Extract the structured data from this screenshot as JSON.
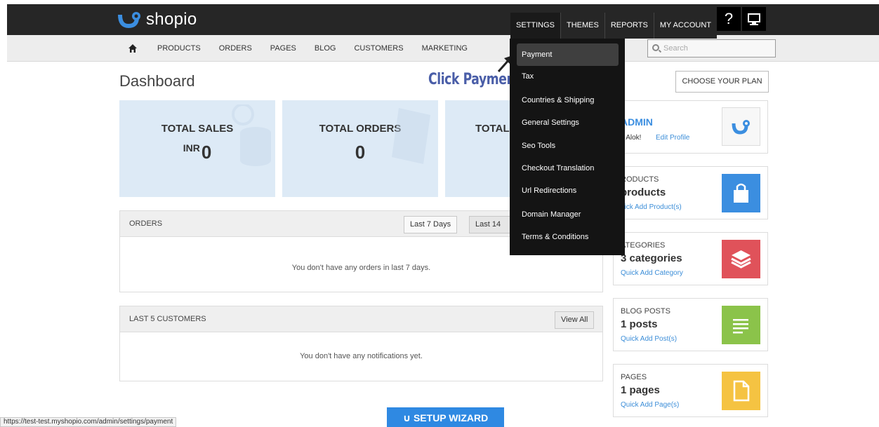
{
  "brand": {
    "name": "shopio"
  },
  "top_menu": {
    "tabs": [
      "SETTINGS",
      "THEMES",
      "REPORTS",
      "MY ACCOUNT"
    ],
    "help_icon": "question-icon",
    "display_icon": "monitor-icon"
  },
  "nav": {
    "items": [
      "PRODUCTS",
      "ORDERS",
      "PAGES",
      "BLOG",
      "CUSTOMERS",
      "MARKETING"
    ],
    "search_placeholder": "Search"
  },
  "page": {
    "title": "Dashboard",
    "annotation": "Click Payment"
  },
  "stats": [
    {
      "title": "TOTAL SALES",
      "currency": "INR",
      "value": "0"
    },
    {
      "title": "TOTAL ORDERS",
      "currency": "",
      "value": "0"
    },
    {
      "title": "TOTAL",
      "currency": "",
      "value": ""
    }
  ],
  "orders_panel": {
    "title": "ORDERS",
    "buttons": [
      "Last 7 Days",
      "Last 14 D"
    ],
    "empty_text": "You don't have any orders in last 7 days."
  },
  "customers_panel": {
    "title": "LAST 5 CUSTOMERS",
    "button": "View All",
    "empty_text": "You don't have any notifications yet."
  },
  "sidebar": {
    "plan_button": "CHOOSE YOUR PLAN",
    "admin": {
      "title": "ADMIN",
      "greeting": "i, Alok!",
      "edit_link": "Edit Profile"
    },
    "products": {
      "label": "RODUCTS",
      "count": " products",
      "link": "uick Add Product(s)",
      "color": "#3b8ee0"
    },
    "categories": {
      "label": "ATEGORIES",
      "count": "3 categories",
      "link": "Quick Add Category",
      "color": "#e0525a"
    },
    "blog": {
      "label": "BLOG POSTS",
      "count": "1 posts",
      "link": "Quick Add Post(s)",
      "color": "#8bc34a"
    },
    "pages": {
      "label": "PAGES",
      "count": "1 pages",
      "link": "Quick Add Page(s)",
      "color": "#f5c342"
    }
  },
  "settings_dropdown": {
    "items": [
      "Payment",
      "Tax",
      "Countries & Shipping",
      "General Settings",
      "Seo Tools",
      "Checkout Translation",
      "Url Redirections",
      "Domain Manager",
      "Terms & Conditions"
    ]
  },
  "setup_wizard": "SETUP WIZARD",
  "status_url": "https://test-test.myshopio.com/admin/settings/payment"
}
